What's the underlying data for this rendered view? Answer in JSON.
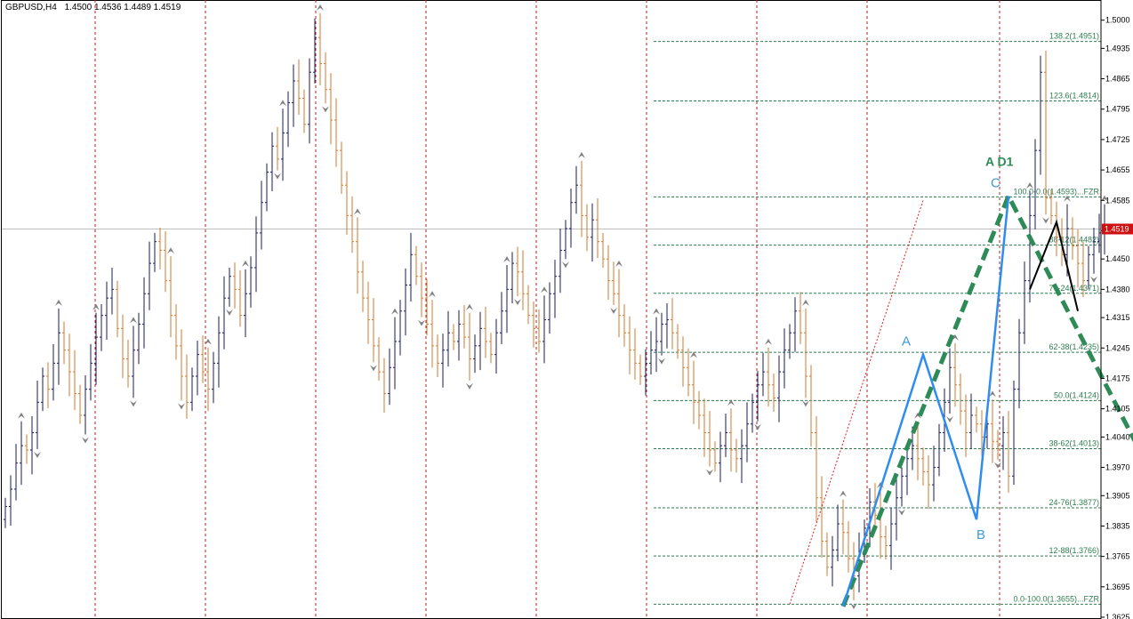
{
  "chart_header": {
    "symbol": "GBPUSD,H4",
    "ohlc": "1.4500 1.4536 1.4489 1.4519"
  },
  "colors": {
    "background": "#ffffff",
    "bull_bar": "#1a1a5e",
    "bear_bar": "#d07a2c",
    "separator": "#b22222",
    "fib_line": "#2e7d4f",
    "pattern_line": "#2f8cf0",
    "projection_line": "#2e8b57",
    "current_price_line": "#c0c0c0",
    "price_tag_bg": "#d01010",
    "fractal": "#808080"
  },
  "icons": {
    "fractal_up": "chevron-up-icon",
    "fractal_down": "chevron-down-icon"
  },
  "chart_data": {
    "type": "candlestick",
    "symbol": "GBPUSD",
    "timeframe": "H4",
    "ylim": [
      1.3625,
      1.503
    ],
    "y_ticks": [
      "1.5000",
      "1.4935",
      "1.4865",
      "1.4795",
      "1.4725",
      "1.4655",
      "1.4585",
      "1.4515",
      "1.4450",
      "1.4380",
      "1.4315",
      "1.4245",
      "1.4175",
      "1.4105",
      "1.4040",
      "1.3970",
      "1.3905",
      "1.3835",
      "1.3765",
      "1.3695",
      "1.3625"
    ],
    "current_price": "1.4519",
    "fib_levels": [
      {
        "label": "138.2(1.4951)",
        "value": 1.4951
      },
      {
        "label": "123.6(1.4814)",
        "value": 1.4814
      },
      {
        "label": "100.0-0.0(1.4593)...FZR",
        "value": 1.4593
      },
      {
        "label": "88-12(1.4482)",
        "value": 1.4482
      },
      {
        "label": "76-24(1.4371)",
        "value": 1.4371
      },
      {
        "label": "62-38(1.4235)",
        "value": 1.4235
      },
      {
        "label": "50.0(1.4124)",
        "value": 1.4124
      },
      {
        "label": "38-62(1.4013)",
        "value": 1.4013
      },
      {
        "label": "24-76(1.3877)",
        "value": 1.3877
      },
      {
        "label": "12-88(1.3766)",
        "value": 1.3766
      },
      {
        "label": "0.0-100.0(1.3655)...FZR",
        "value": 1.3655
      }
    ],
    "pattern_points": [
      {
        "label": "",
        "bar": 157,
        "price": 1.365
      },
      {
        "label": "A",
        "bar": 172,
        "price": 1.423
      },
      {
        "label": "B",
        "bar": 182,
        "price": 1.385
      },
      {
        "label": "C",
        "bar": 188,
        "price": 1.4595
      }
    ],
    "pattern_title": "A D1",
    "projection": {
      "points": [
        {
          "bar": 157,
          "price": 1.365
        },
        {
          "bar": 188,
          "price": 1.4595
        },
        {
          "bar": 218,
          "price": 1.388
        }
      ]
    },
    "recent_swing": [
      {
        "bar": 192,
        "price": 1.438
      },
      {
        "bar": 197,
        "price": 1.4535
      },
      {
        "bar": 201,
        "price": 1.433
      }
    ],
    "trend_line": {
      "from": {
        "bar": 147,
        "price": 1.3655
      },
      "to": {
        "bar": 172,
        "price": 1.4585
      }
    },
    "bar_closes": [
      1.388,
      1.392,
      1.398,
      1.402,
      1.401,
      1.405,
      1.412,
      1.418,
      1.415,
      1.421,
      1.428,
      1.424,
      1.419,
      1.414,
      1.409,
      1.415,
      1.421,
      1.427,
      1.432,
      1.436,
      1.438,
      1.429,
      1.422,
      1.418,
      1.424,
      1.43,
      1.437,
      1.444,
      1.449,
      1.447,
      1.44,
      1.432,
      1.425,
      1.418,
      1.412,
      1.418,
      1.423,
      1.419,
      1.415,
      1.421,
      1.428,
      1.436,
      1.441,
      1.438,
      1.432,
      1.437,
      1.443,
      1.451,
      1.458,
      1.465,
      1.471,
      1.468,
      1.474,
      1.481,
      1.486,
      1.482,
      1.476,
      1.488,
      1.496,
      1.49,
      1.484,
      1.477,
      1.47,
      1.462,
      1.455,
      1.449,
      1.442,
      1.436,
      1.431,
      1.425,
      1.419,
      1.414,
      1.42,
      1.426,
      1.433,
      1.439,
      1.446,
      1.441,
      1.436,
      1.43,
      1.425,
      1.421,
      1.424,
      1.428,
      1.426,
      1.43,
      1.427,
      1.422,
      1.425,
      1.429,
      1.426,
      1.423,
      1.428,
      1.433,
      1.438,
      1.444,
      1.442,
      1.437,
      1.432,
      1.429,
      1.426,
      1.431,
      1.437,
      1.441,
      1.447,
      1.452,
      1.458,
      1.462,
      1.455,
      1.45,
      1.454,
      1.449,
      1.445,
      1.44,
      1.437,
      1.432,
      1.428,
      1.424,
      1.421,
      1.418,
      1.421,
      1.424,
      1.426,
      1.43,
      1.431,
      1.428,
      1.424,
      1.42,
      1.416,
      1.412,
      1.409,
      1.405,
      1.401,
      1.398,
      1.402,
      1.405,
      1.401,
      1.399,
      1.402,
      1.407,
      1.412,
      1.416,
      1.419,
      1.416,
      1.413,
      1.419,
      1.424,
      1.428,
      1.433,
      1.428,
      1.418,
      1.405,
      1.39,
      1.38,
      1.374,
      1.378,
      1.384,
      1.382,
      1.376,
      1.372,
      1.377,
      1.383,
      1.389,
      1.386,
      1.381,
      1.379,
      1.384,
      1.39,
      1.395,
      1.399,
      1.402,
      1.399,
      1.396,
      1.393,
      1.397,
      1.405,
      1.412,
      1.42,
      1.416,
      1.41,
      1.405,
      1.409,
      1.407,
      1.404,
      1.407,
      1.403,
      1.402,
      1.405,
      1.395,
      1.415,
      1.428,
      1.44,
      1.455,
      1.47,
      1.488,
      1.459,
      1.455,
      1.45,
      1.446,
      1.452,
      1.448,
      1.444,
      1.44,
      1.446,
      1.449,
      1.451,
      1.452
    ]
  }
}
